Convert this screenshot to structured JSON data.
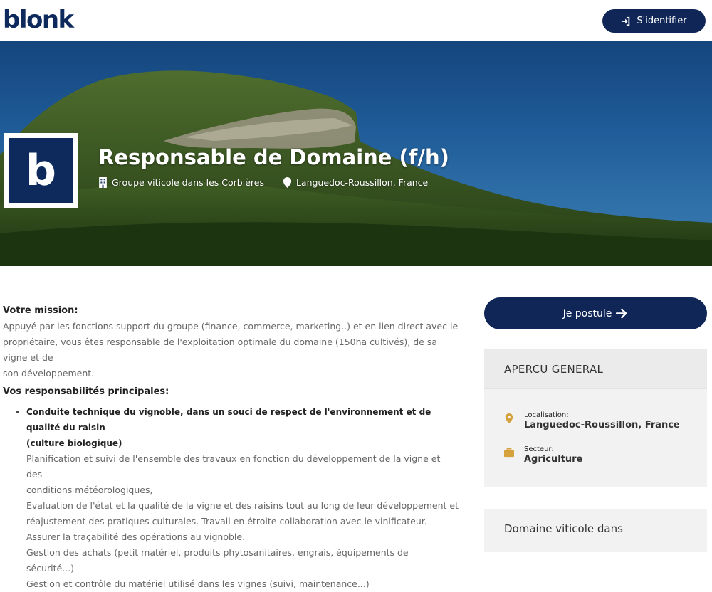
{
  "header": {
    "logo": "blonk",
    "login_label": "S'identifier"
  },
  "hero": {
    "company_initial": "b",
    "title": "Responsable de Domaine (f/h)",
    "company": "Groupe viticole dans les Corbières",
    "location": "Languedoc-Roussillon, France"
  },
  "content": {
    "mission_heading": "Votre mission:",
    "mission_lines": [
      "Appuyé par les fonctions support du groupe (finance, commerce, marketing..) et en lien direct avec le",
      "propriétaire, vous êtes responsable de l'exploitation optimale du domaine (150ha cultivés), de sa vigne et de",
      "son développement."
    ],
    "resp_heading": "Vos responsabilités principales:",
    "item1_title_lines": [
      "Conduite technique du vignoble, dans un souci de respect de l'environnement et de qualité du raisin",
      "(culture biologique)"
    ],
    "item1_lines": [
      "Planification et suivi de l'ensemble des travaux en fonction du développement de la vigne et des",
      "conditions météorologiques,",
      "Evaluation de l'état et la qualité de la vigne et des raisins tout au long de leur développement et",
      "réajustement des pratiques culturales. Travail en étroite collaboration avec le vinificateur.",
      "Assurer la traçabilité des opérations au vignoble.",
      "Gestion des achats (petit matériel, produits phytosanitaires, engrais, équipements de sécurité...)",
      "Gestion et contrôle du matériel utilisé dans les vignes (suivi, maintenance...)"
    ]
  },
  "sidebar": {
    "apply_label": "Je postule",
    "overview_title": "APERCU GENERAL",
    "location_label": "Localisation:",
    "location_value": "Languedoc-Roussillon, France",
    "sector_label": "Secteur:",
    "sector_value": "Agriculture",
    "next_panel_title": "Domaine viticole dans"
  },
  "colors": {
    "brand_navy": "#0f2657",
    "icon_gold": "#d4a13a"
  }
}
